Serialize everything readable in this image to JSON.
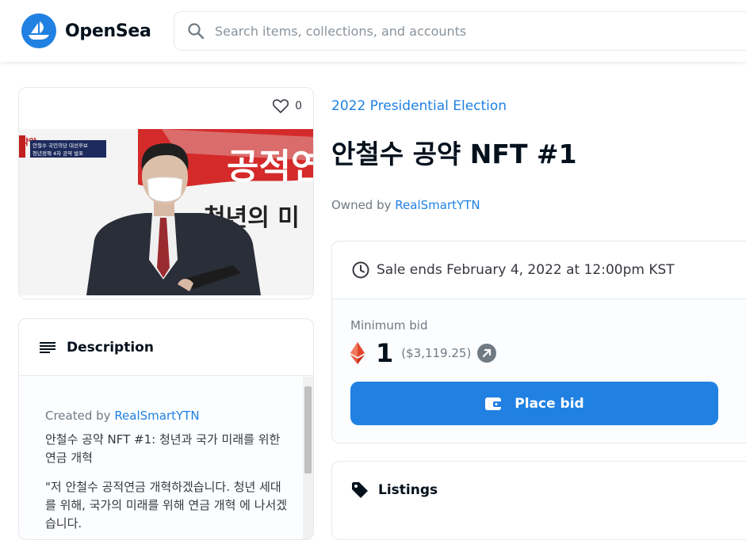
{
  "header": {
    "brand": "OpenSea",
    "search_placeholder": "Search items, collections, and accounts"
  },
  "item": {
    "favorites_count": "0",
    "collection": "2022 Presidential Election",
    "title": "안철수 공약 NFT #1",
    "owned_by_label": "Owned by ",
    "owner": "RealSmartYTN"
  },
  "image_text": {
    "banner_main": "공적연",
    "banner_sub": "청년의 미",
    "caption_top": "안철수 국민의당 대선후보",
    "caption_bottom": "청년정책 4차 공약 발표",
    "corner": "약앞"
  },
  "description": {
    "heading": "Description",
    "created_by_label": "Created by ",
    "creator": "RealSmartYTN",
    "line1": "안철수 공약 NFT #1: 청년과 국가 미래를 위한 연금 개혁",
    "line2": "\"저 안철수 공적연금 개혁하겠습니다. 청년 세대를 위해, 국가의 미래를 위해 연금 개혁 에 나서겠습니다."
  },
  "sale": {
    "ends": "Sale ends February 4, 2022 at 12:00pm KST",
    "min_bid_label": "Minimum bid",
    "price": "1",
    "usd": "($3,119.25)",
    "place_bid": "Place bid"
  },
  "listings": {
    "heading": "Listings"
  },
  "colors": {
    "accent": "#2081e2",
    "text": "#04111d",
    "muted": "#707a83"
  }
}
